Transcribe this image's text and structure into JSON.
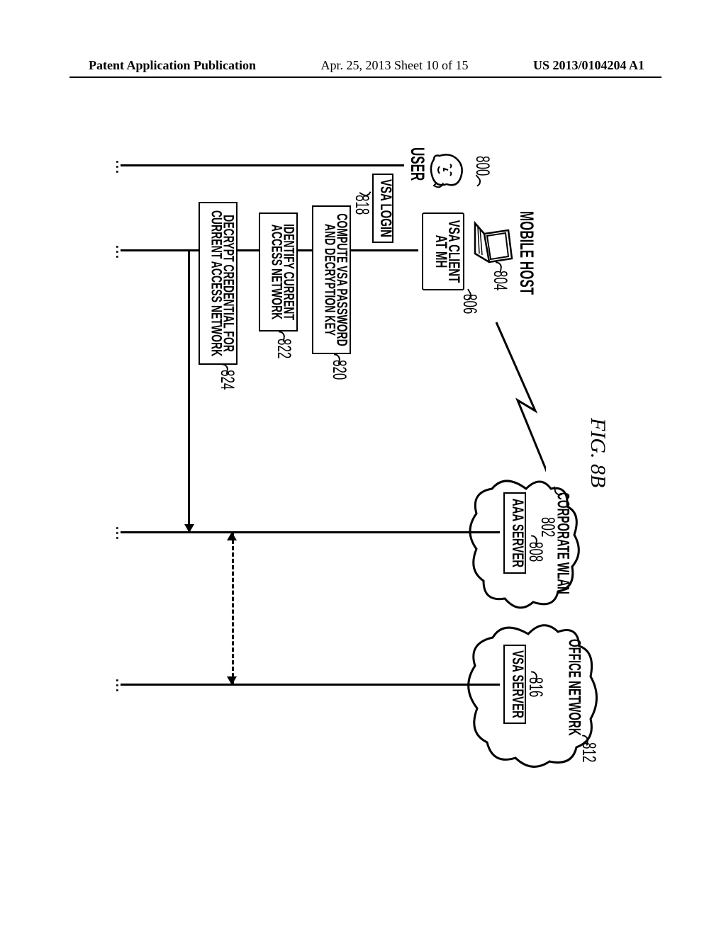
{
  "header": {
    "left": "Patent Application Publication",
    "center": "Apr. 25, 2013  Sheet 10 of 15",
    "right": "US 2013/0104204 A1"
  },
  "figure": {
    "title": "FIG. 8B",
    "user": {
      "label": "USER",
      "ref": "800"
    },
    "mobile_host": {
      "label": "MOBILE HOST",
      "ref": "804"
    },
    "vsa_client": {
      "line1": "VSA CLIENT",
      "line2": "AT MH",
      "ref": "806"
    },
    "corp_wlan": {
      "label": "CORPORATE WLAN",
      "ref": "802"
    },
    "aaa": {
      "label": "AAA SERVER",
      "ref": "808"
    },
    "office": {
      "label": "OFFICE NETWORK",
      "ref": "812"
    },
    "vsa_server": {
      "label": "VSA SERVER",
      "ref": "816"
    },
    "vsa_login": {
      "label": "VSA LOGIN",
      "ref": "818"
    },
    "box820": {
      "line1": "COMPUTE VSA PASSWORD",
      "line2": "AND DECRYPTION KEY",
      "ref": "820"
    },
    "box822": {
      "line1": "IDENTIFY CURRENT",
      "line2": "ACCESS NETWORK",
      "ref": "822"
    },
    "box824": {
      "line1": "DECRYPT CREDENTIAL FOR",
      "line2": "CURRENT ACCESS NETWORK",
      "ref": "824"
    }
  }
}
